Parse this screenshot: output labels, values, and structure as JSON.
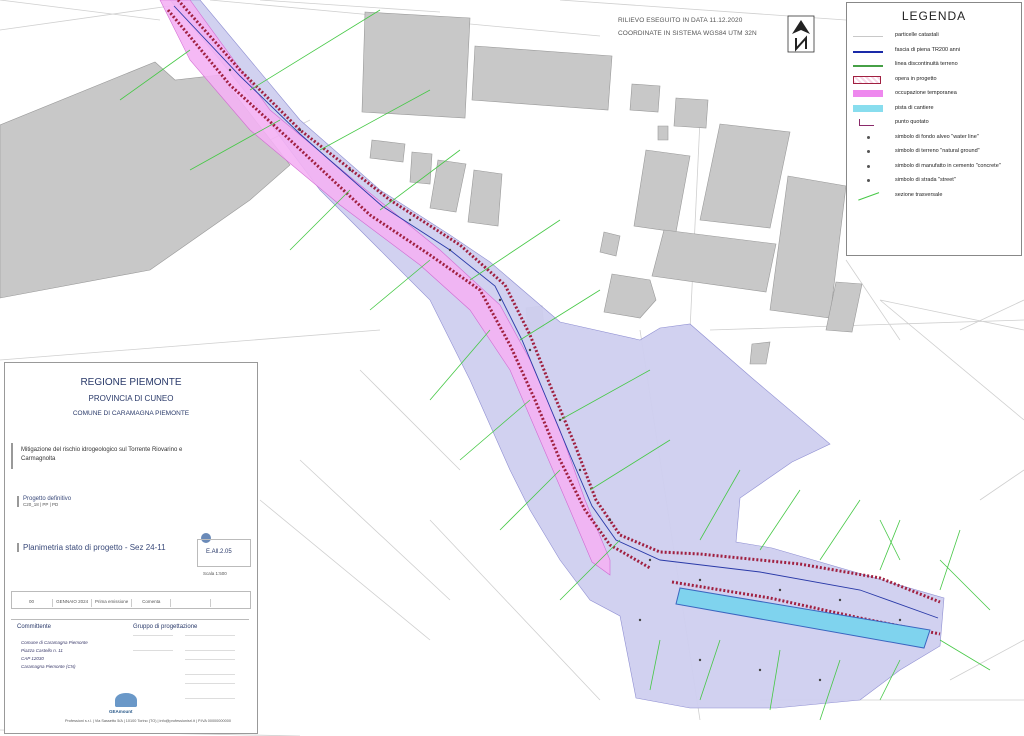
{
  "survey": {
    "line1": "RILIEVO ESEGUITO IN DATA 11.12.2020",
    "line2": "COORDINATE IN SISTEMA WGS84 UTM 32N"
  },
  "legend": {
    "title": "LEGENDA",
    "items": [
      {
        "label": "particelle catastali",
        "symbol": "thin-line",
        "color": "#c8c8c8"
      },
      {
        "label": "fascia di piena TR200 anni",
        "symbol": "line",
        "color": "#1a2aa8"
      },
      {
        "label": "linea discontinuità terreno",
        "symbol": "line",
        "color": "#46a046"
      },
      {
        "label": "opera in progetto",
        "symbol": "hatched-box",
        "color": "#a02040"
      },
      {
        "label": "occupazione temporanea",
        "symbol": "fill",
        "color": "#ee88ee"
      },
      {
        "label": "pista di cantiere",
        "symbol": "fill",
        "color": "#88ddee"
      },
      {
        "label": "punto quotato",
        "symbol": "point-label",
        "color": "#8a2a6a"
      },
      {
        "label": "simbolo di fondo alveo \"water line\"",
        "symbol": "dot",
        "color": "#555555"
      },
      {
        "label": "simbolo di terreno \"natural ground\"",
        "symbol": "dot",
        "color": "#555555"
      },
      {
        "label": "simbolo di manufatto in cemento \"concrete\"",
        "symbol": "dot",
        "color": "#555555"
      },
      {
        "label": "simbolo di strada \"street\"",
        "symbol": "dot",
        "color": "#555555"
      },
      {
        "label": "sezione trasversale",
        "symbol": "section",
        "color": "#46c846"
      }
    ]
  },
  "titleblock": {
    "region": "REGIONE PIEMONTE",
    "province": "PROVINCIA DI CUNEO",
    "commune": "COMUNE DI CARAMAGNA PIEMONTE",
    "project_line1": "Mitigazione del rischio idrogeologico sul Torrente Riovarino e",
    "project_line2": "Carmagnolta",
    "phase": "Progetto definitivo",
    "code": "C20_18 | PP | PD",
    "drawing": "Planimetria stato di progetto - Sez 24-11",
    "sheet": "E.All.2.05",
    "scale": "Scala 1:500",
    "revision_row": [
      "00",
      "GENNAIO 2024",
      "Prima emissione",
      "Comenta",
      "",
      ""
    ],
    "client_title": "Committente",
    "client_lines": [
      "Comune di Caramagna Piemonte",
      "Piazza Castello n. 11",
      "CAP 12030",
      "Caramagna Piemonte (CN)"
    ],
    "designers_title": "Gruppo di progettazione",
    "logo_text": "GEAmount",
    "footer": "Professioni s.r.l. | Via Sassetto 5/A | 10100 Torino (TO) | info@professionisrl.it | P.IVA 00000000000"
  },
  "colors": {
    "buildings": "#c8c8c8",
    "occupation": "#cfcff0",
    "corridor": "#f2aaf2",
    "work": "#a02040",
    "flood": "#2a3aa8",
    "pista": "#7fd3ee",
    "section": "#46c846"
  }
}
